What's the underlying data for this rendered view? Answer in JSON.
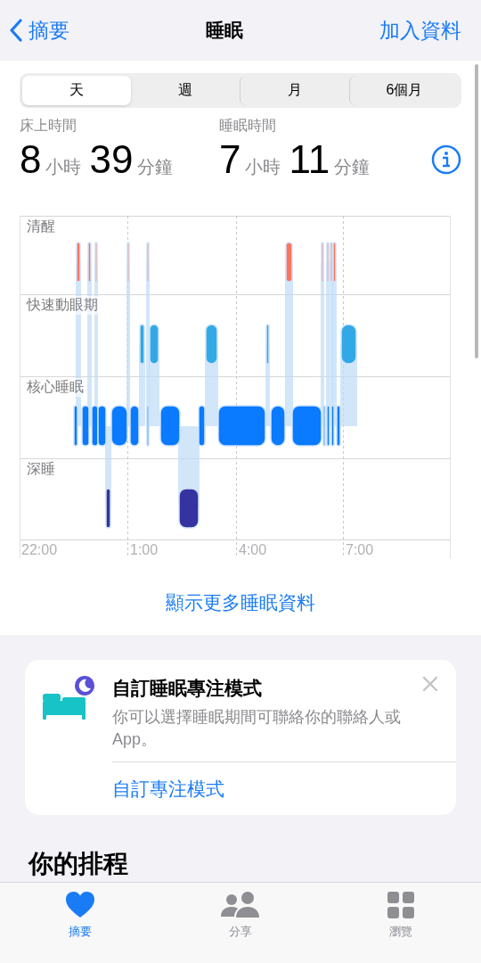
{
  "nav": {
    "back": "摘要",
    "title": "睡眠",
    "action": "加入資料"
  },
  "periods": [
    {
      "label": "天",
      "selected": true
    },
    {
      "label": "週",
      "selected": false
    },
    {
      "label": "月",
      "selected": false
    },
    {
      "label": "6個月",
      "selected": false
    }
  ],
  "stats": [
    {
      "label": "床上時間",
      "hours": "8",
      "hours_unit": "小時",
      "minutes": "39",
      "minutes_unit": "分鐘"
    },
    {
      "label": "睡眠時間",
      "hours": "7",
      "hours_unit": "小時",
      "minutes": "11",
      "minutes_unit": "分鐘"
    }
  ],
  "chart": {
    "stages": [
      "清醒",
      "快速動眼期",
      "核心睡眠",
      "深睡"
    ],
    "times": [
      "22:00",
      "1:00",
      "4:00",
      "7:00"
    ]
  },
  "more_link": "顯示更多睡眠資料",
  "focus_card": {
    "title": "自訂睡眠專注模式",
    "body": "你可以選擇睡眠期間可聯絡你的聯絡人或 App。",
    "action": "自訂專注模式"
  },
  "schedule_heading": "你的排程",
  "tab_bar": [
    {
      "label": "摘要",
      "kind": "heart",
      "selected": true
    },
    {
      "label": "分享",
      "kind": "people",
      "selected": false
    },
    {
      "label": "瀏覽",
      "kind": "grid",
      "selected": false
    }
  ]
}
